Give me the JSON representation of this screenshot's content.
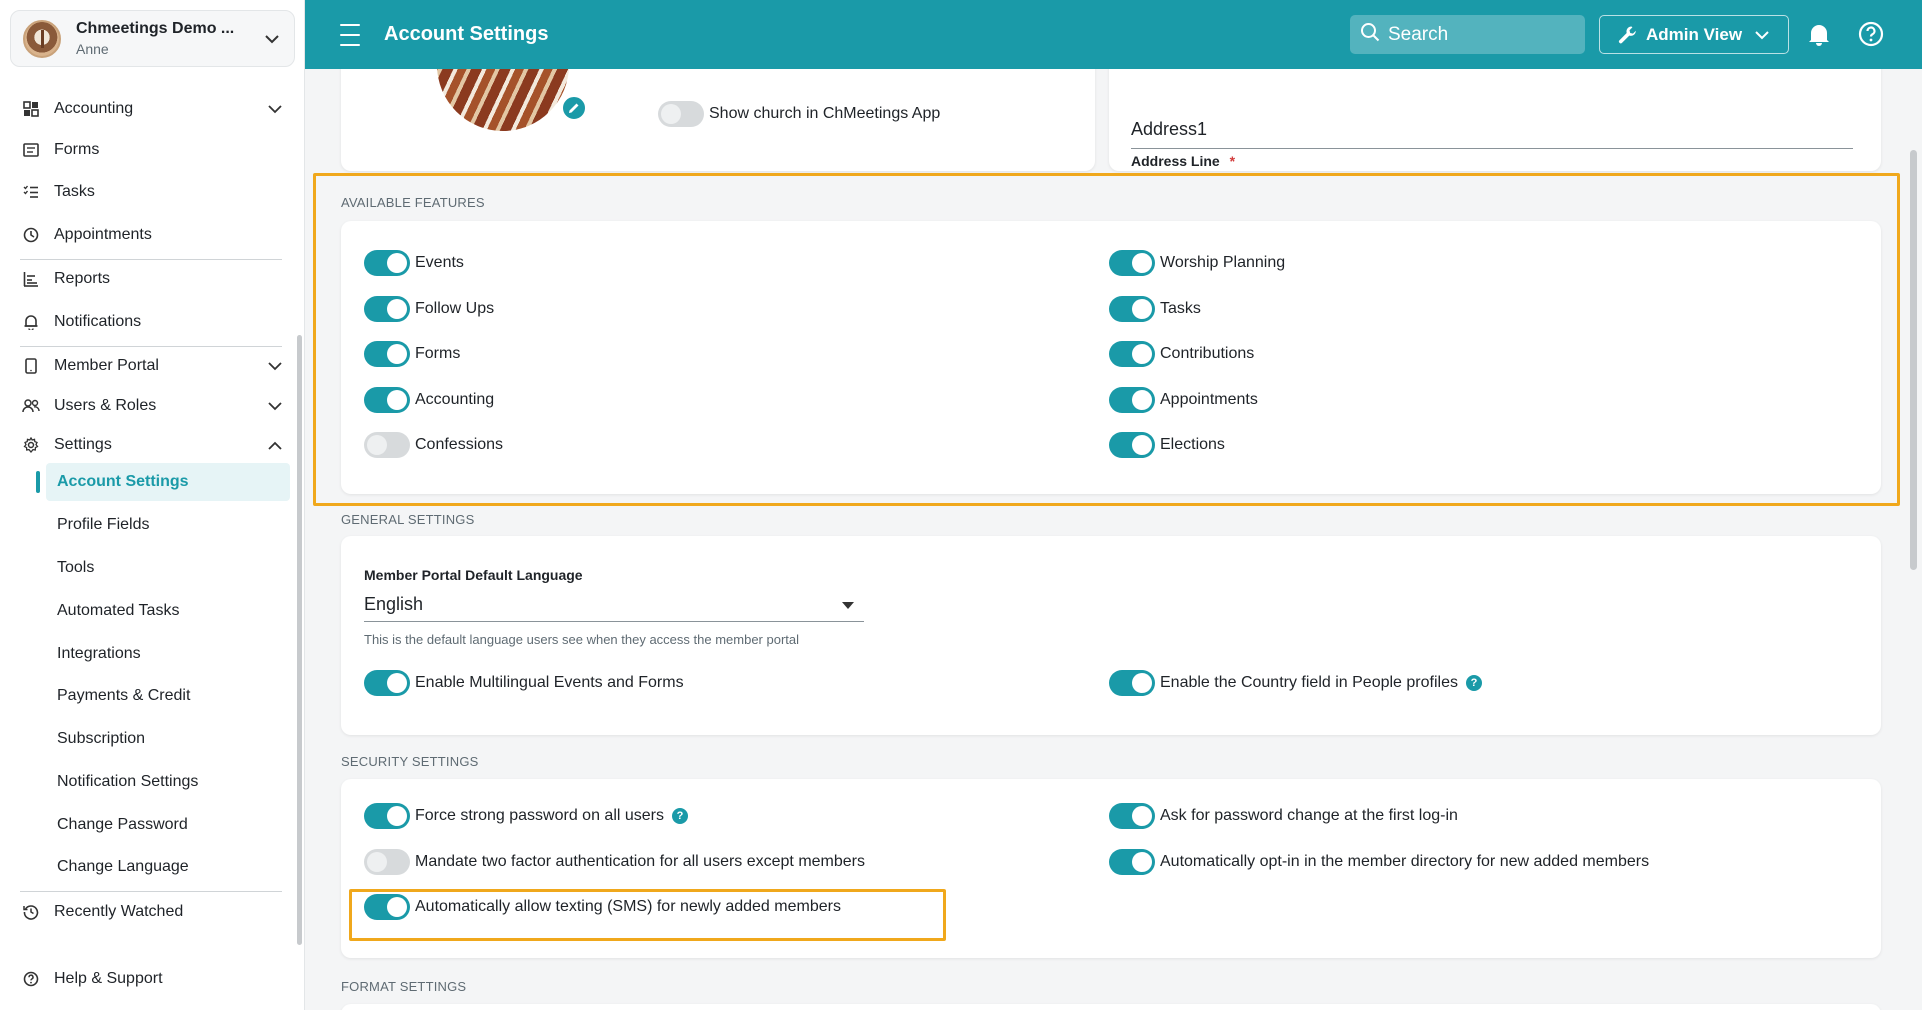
{
  "org": {
    "name": "Chmeetings Demo ...",
    "user": "Anne"
  },
  "nav": {
    "accounting": "Accounting",
    "forms": "Forms",
    "tasks": "Tasks",
    "appointments": "Appointments",
    "reports": "Reports",
    "notifications": "Notifications",
    "member_portal": "Member Portal",
    "users_roles": "Users & Roles",
    "settings": "Settings",
    "settings_items": [
      "Account Settings",
      "Profile Fields",
      "Tools",
      "Automated Tasks",
      "Integrations",
      "Payments & Credit",
      "Subscription",
      "Notification Settings",
      "Change Password",
      "Change Language"
    ],
    "recently_watched": "Recently Watched",
    "help_support": "Help & Support"
  },
  "header": {
    "title": "Account Settings",
    "search_placeholder": "Search",
    "admin_view": "Admin View"
  },
  "top": {
    "show_church": "Show church in ChMeetings App",
    "address_label": "Address Line",
    "address_required": "*",
    "address_value": "Address1"
  },
  "features": {
    "title": "AVAILABLE FEATURES",
    "left": [
      {
        "label": "Events",
        "on": true
      },
      {
        "label": "Follow Ups",
        "on": true
      },
      {
        "label": "Forms",
        "on": true
      },
      {
        "label": "Accounting",
        "on": true
      },
      {
        "label": "Confessions",
        "on": false
      }
    ],
    "right": [
      {
        "label": "Worship Planning",
        "on": true
      },
      {
        "label": "Tasks",
        "on": true
      },
      {
        "label": "Contributions",
        "on": true
      },
      {
        "label": "Appointments",
        "on": true
      },
      {
        "label": "Elections",
        "on": true
      }
    ]
  },
  "general": {
    "title": "GENERAL SETTINGS",
    "language_label": "Member Portal Default Language",
    "language_value": "English",
    "language_hint": "This is the default language users see when they access the member portal",
    "multilingual": "Enable Multilingual Events and Forms",
    "country_field": "Enable the Country field in People profiles",
    "help_glyph": "?"
  },
  "security": {
    "title": "SECURITY SETTINGS",
    "strong_password": "Force strong password on all users",
    "two_factor": "Mandate two factor authentication for all users except members",
    "sms": "Automatically allow texting (SMS) for newly added members",
    "password_change": "Ask for password change at the first log-in",
    "opt_in": "Automatically opt-in in the member directory for new added members"
  },
  "format": {
    "title": "FORMAT SETTINGS"
  },
  "colors": {
    "accent": "#1a9aa8",
    "highlight": "#f0a81c"
  }
}
